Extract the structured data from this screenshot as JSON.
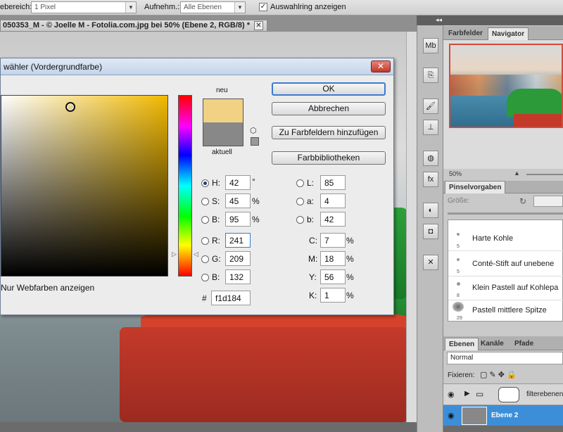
{
  "options_bar": {
    "sample_label": "ebereich:",
    "sample_value": "1 Pixel",
    "layers_label": "Aufnehm.:",
    "layers_value": "Alle Ebenen",
    "ring_label": "Auswahlring anzeigen",
    "ring_checked": "✓"
  },
  "document": {
    "tab_title": "050353_M - © Joelle M - Fotolia.com.jpg bei 50% (Ebene 2, RGB/8) *",
    "close": "✕"
  },
  "dialog": {
    "title": "wähler (Vordergrundfarbe)",
    "close": "✕",
    "new_label": "neu",
    "current_label": "aktuell",
    "web_only_label": "Nur Webfarben anzeigen",
    "buttons": {
      "ok": "OK",
      "cancel": "Abbrechen",
      "add_swatch": "Zu Farbfeldern hinzufügen",
      "libraries": "Farbbibliotheken"
    },
    "fields": {
      "H": {
        "label": "H:",
        "value": "42",
        "unit": "°"
      },
      "S": {
        "label": "S:",
        "value": "45",
        "unit": "%"
      },
      "Bv": {
        "label": "B:",
        "value": "95",
        "unit": "%"
      },
      "R": {
        "label": "R:",
        "value": "241"
      },
      "G": {
        "label": "G:",
        "value": "209"
      },
      "Bl": {
        "label": "B:",
        "value": "132"
      },
      "L": {
        "label": "L:",
        "value": "85"
      },
      "a": {
        "label": "a:",
        "value": "4"
      },
      "b": {
        "label": "b:",
        "value": "42"
      },
      "C": {
        "label": "C:",
        "value": "7",
        "unit": "%"
      },
      "M": {
        "label": "M:",
        "value": "18",
        "unit": "%"
      },
      "Y": {
        "label": "Y:",
        "value": "56",
        "unit": "%"
      },
      "K": {
        "label": "K:",
        "value": "1",
        "unit": "%"
      }
    },
    "hex_label": "#",
    "hex_value": "f1d184",
    "new_color": "#f1d184",
    "current_color": "#888888"
  },
  "panels": {
    "collapse": "◂◂",
    "nav_tabs": [
      "Farbfelder",
      "Navigator"
    ],
    "nav_zoom": "50%",
    "brush_tab": "Pinselvorgaben",
    "brush_size_label": "Größe:",
    "brushes": [
      {
        "name": "Harte Kohle",
        "size": "5"
      },
      {
        "name": "Conté-Stift auf unebene",
        "size": "5"
      },
      {
        "name": "Klein Pastell auf Kohlepa",
        "size": "8"
      },
      {
        "name": "Pastell mittlere Spitze",
        "size": "29"
      }
    ],
    "layer_tabs": [
      "Ebenen",
      "Kanäle",
      "Pfade"
    ],
    "blend_mode": "Normal",
    "lock_label": "Fixieren:",
    "layers": [
      {
        "name": "filterebenen"
      },
      {
        "name": "Ebene 2"
      }
    ]
  },
  "strip_icons": [
    "Mb",
    "layers-comp",
    "brush",
    "stamp",
    "palette",
    "fx",
    "contrast",
    "mask",
    "tools"
  ]
}
